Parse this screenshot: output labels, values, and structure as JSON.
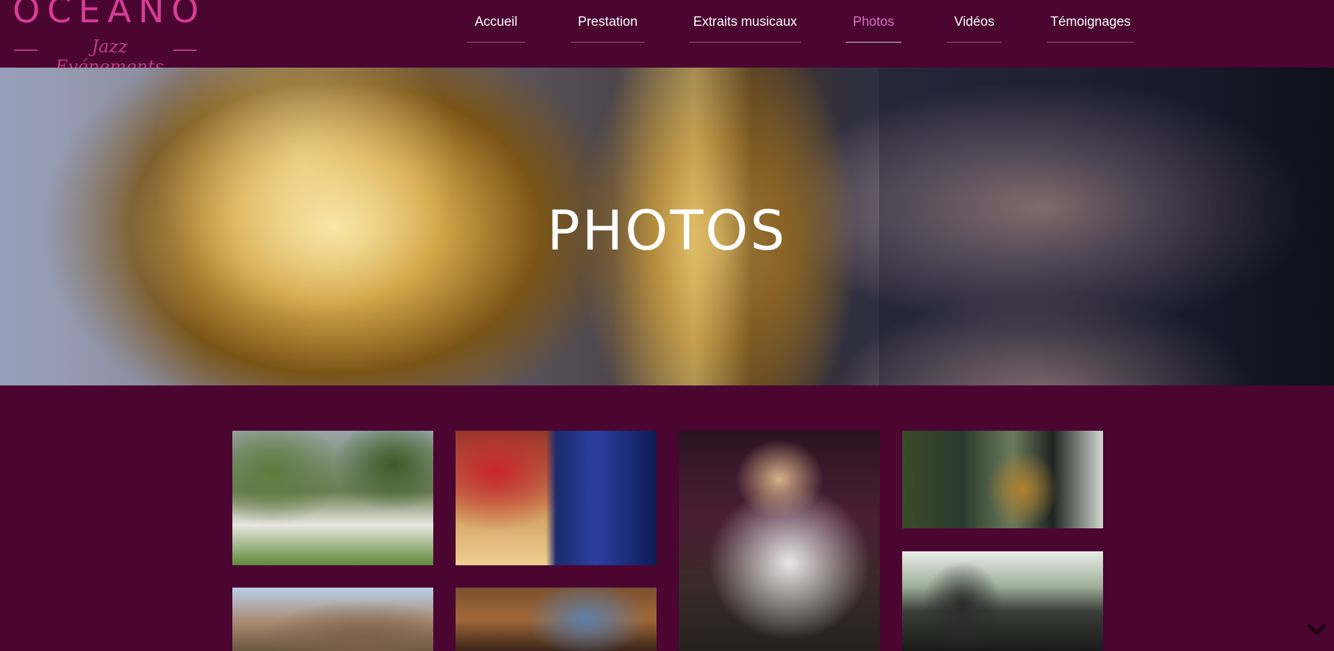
{
  "header": {
    "logo": {
      "main": "OCEANO",
      "sub": "Jazz Evénements"
    },
    "nav": [
      {
        "label": "Accueil",
        "active": false
      },
      {
        "label": "Prestation",
        "active": false
      },
      {
        "label": "Extraits musicaux",
        "active": false
      },
      {
        "label": "Photos",
        "active": true
      },
      {
        "label": "Vidéos",
        "active": false
      },
      {
        "label": "Témoignages",
        "active": false
      }
    ]
  },
  "hero": {
    "title": "PHOTOS"
  },
  "gallery": {
    "photos": [
      {
        "subject": "garden reception with musicians"
      },
      {
        "subject": "jazz trio and mixing console"
      },
      {
        "subject": "guitarist playing"
      },
      {
        "subject": "guitar and saxophone duo in glass hall"
      },
      {
        "subject": "stone house with saxophonist"
      },
      {
        "subject": "musicians in window-lit room"
      },
      {
        "subject": "jazz band posing with instruments"
      }
    ]
  },
  "colors": {
    "background": "#4a0530",
    "brand_pink": "#d83c95",
    "nav_active": "#d970c8",
    "text": "#ffffff"
  },
  "icons": {
    "scroll": "chevron-down-icon"
  }
}
